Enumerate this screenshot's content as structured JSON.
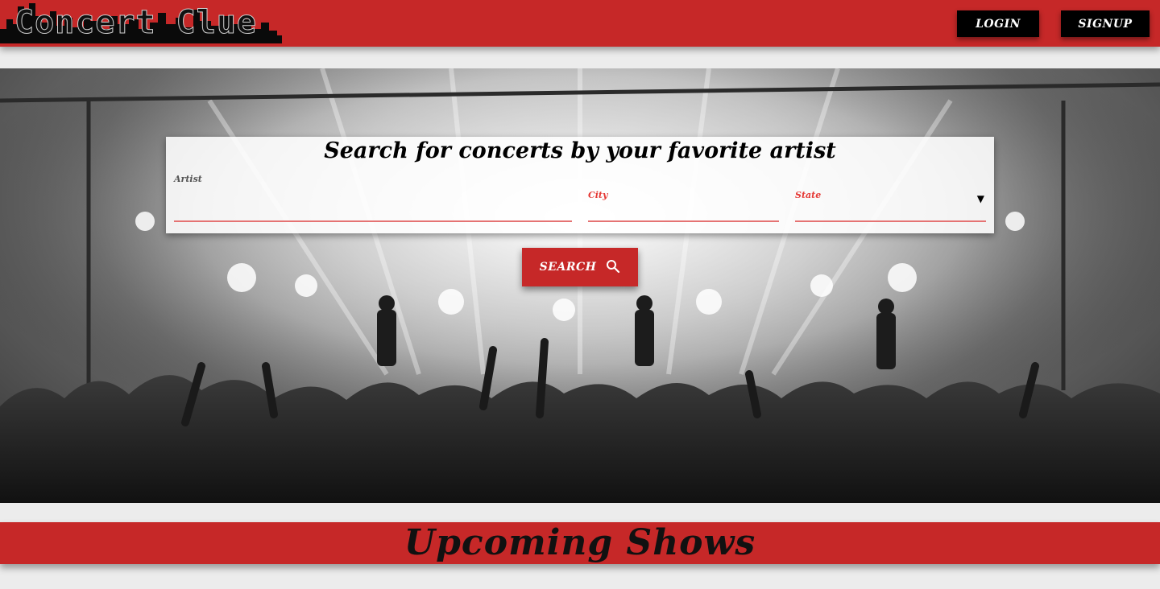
{
  "header": {
    "logo_text": "Concert Clue",
    "login_label": "LOGIN",
    "signup_label": "SIGNUP",
    "brand_color": "#c62828"
  },
  "search": {
    "title": "Search for concerts by your favorite artist",
    "artist_label": "Artist",
    "artist_value": "",
    "city_label": "City",
    "city_value": "",
    "state_label": "State",
    "state_value": "",
    "button_label": "SEARCH",
    "button_icon": "search-icon"
  },
  "upcoming": {
    "title": "Upcoming Shows"
  }
}
